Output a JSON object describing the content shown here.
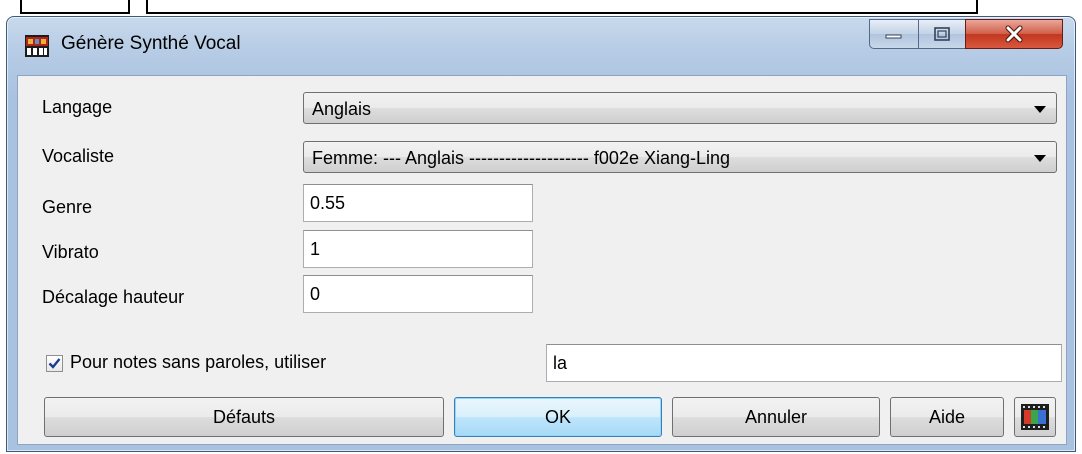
{
  "window": {
    "title": "Génère Synthé Vocal",
    "controls": {
      "minimize": "minimize-icon",
      "maximize": "maximize-icon",
      "close": "close-icon"
    }
  },
  "form": {
    "language": {
      "label": "Langage",
      "value": "Anglais"
    },
    "vocalist": {
      "label": "Vocaliste",
      "value": "Femme: --- Anglais -------------------- f002e Xiang-Ling"
    },
    "gender": {
      "label": "Genre",
      "value": "0.55"
    },
    "vibrato": {
      "label": "Vibrato",
      "value": "1"
    },
    "pitch_offset": {
      "label": "Décalage hauteur",
      "value": "0"
    },
    "lyricless": {
      "label": "Pour notes sans paroles, utiliser",
      "checked": true,
      "value": "la"
    }
  },
  "buttons": {
    "defaults": "Défauts",
    "ok": "OK",
    "cancel": "Annuler",
    "help": "Aide",
    "extra_icon": "film-clip-icon"
  },
  "colors": {
    "accent": "#3c7fb1",
    "close": "#c2361f",
    "check": "#1a3d8f"
  }
}
